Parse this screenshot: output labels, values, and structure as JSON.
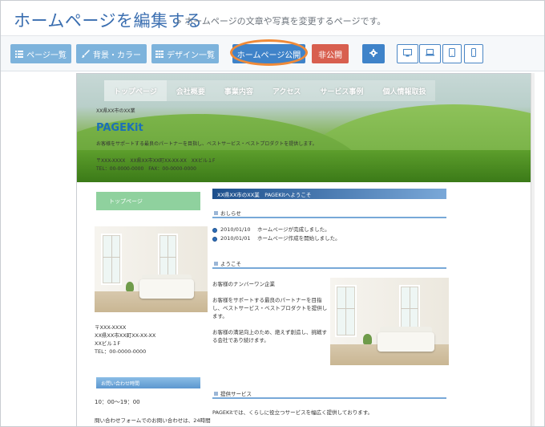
{
  "header": {
    "title": "ホームページを編集する",
    "subtitle": "» ホームページの文章や写真を変更するページです。"
  },
  "toolbar": {
    "page_list": "ページ一覧",
    "background_color": "背景・カラー",
    "design_list": "デザイン一覧",
    "publish_homepage": "ホームページ公開",
    "unpublish": "非公開"
  },
  "preview": {
    "nav": [
      "トップページ",
      "会社概要",
      "事業内容",
      "アクセス",
      "サービス事例",
      "個人情報取扱"
    ],
    "hero": {
      "small_text": "XX県XX市のXX業",
      "brand": "PAGEKit",
      "description": "お客様をサポートする最良のパートナーを目指し、ベストサービス・ベストプロダクトを提供します。",
      "address": "〒XXX-XXXX　XX県XX市XX町XX-XX-XX　XXビル１F",
      "tel": "TEL：00-0000-0000　FAX：00-0000-0000"
    },
    "sidebar": {
      "top_page_button": "トップページ",
      "address_lines": [
        "〒XXX-XXXX",
        "XX県XX市XX町XX-XX-XX",
        "XXビル１F",
        "TEL：00-0000-0000"
      ],
      "contact_hours_label": "お問い合わせ時間",
      "hours": "10：00〜19：00",
      "note": "問い合わせフォームでのお問い合わせは、24時間"
    },
    "main": {
      "header": "XX県XX市のXX業　PAGEKitへようこそ",
      "news_title": "おしらせ",
      "news": [
        {
          "date": "2010/01/10",
          "text": "ホームページが完成しました。"
        },
        {
          "date": "2010/01/01",
          "text": "ホームページ作成を開始しました。"
        }
      ],
      "welcome_title": "ようこそ",
      "welcome_lines": [
        "お客様のナンバーワン企業",
        "",
        "お客様をサポートする最良のパートナーを目指",
        "し、ベストサービス・ベストプロダクトを提供し",
        "ます。",
        "",
        "お客様の満足向上のため、絶えず創造し、挑戦す",
        "る会社であり続けます。"
      ],
      "service_title": "提供サービス",
      "service_text": "PAGEKitでは、くらしに役立つサービスを幅広く提供しております。"
    }
  },
  "colors": {
    "title": "#3a6eb0",
    "button_light": "#7db3dc",
    "button_primary": "#3f83c9",
    "button_danger": "#d85f4f",
    "highlight_ring": "#f08a38"
  }
}
